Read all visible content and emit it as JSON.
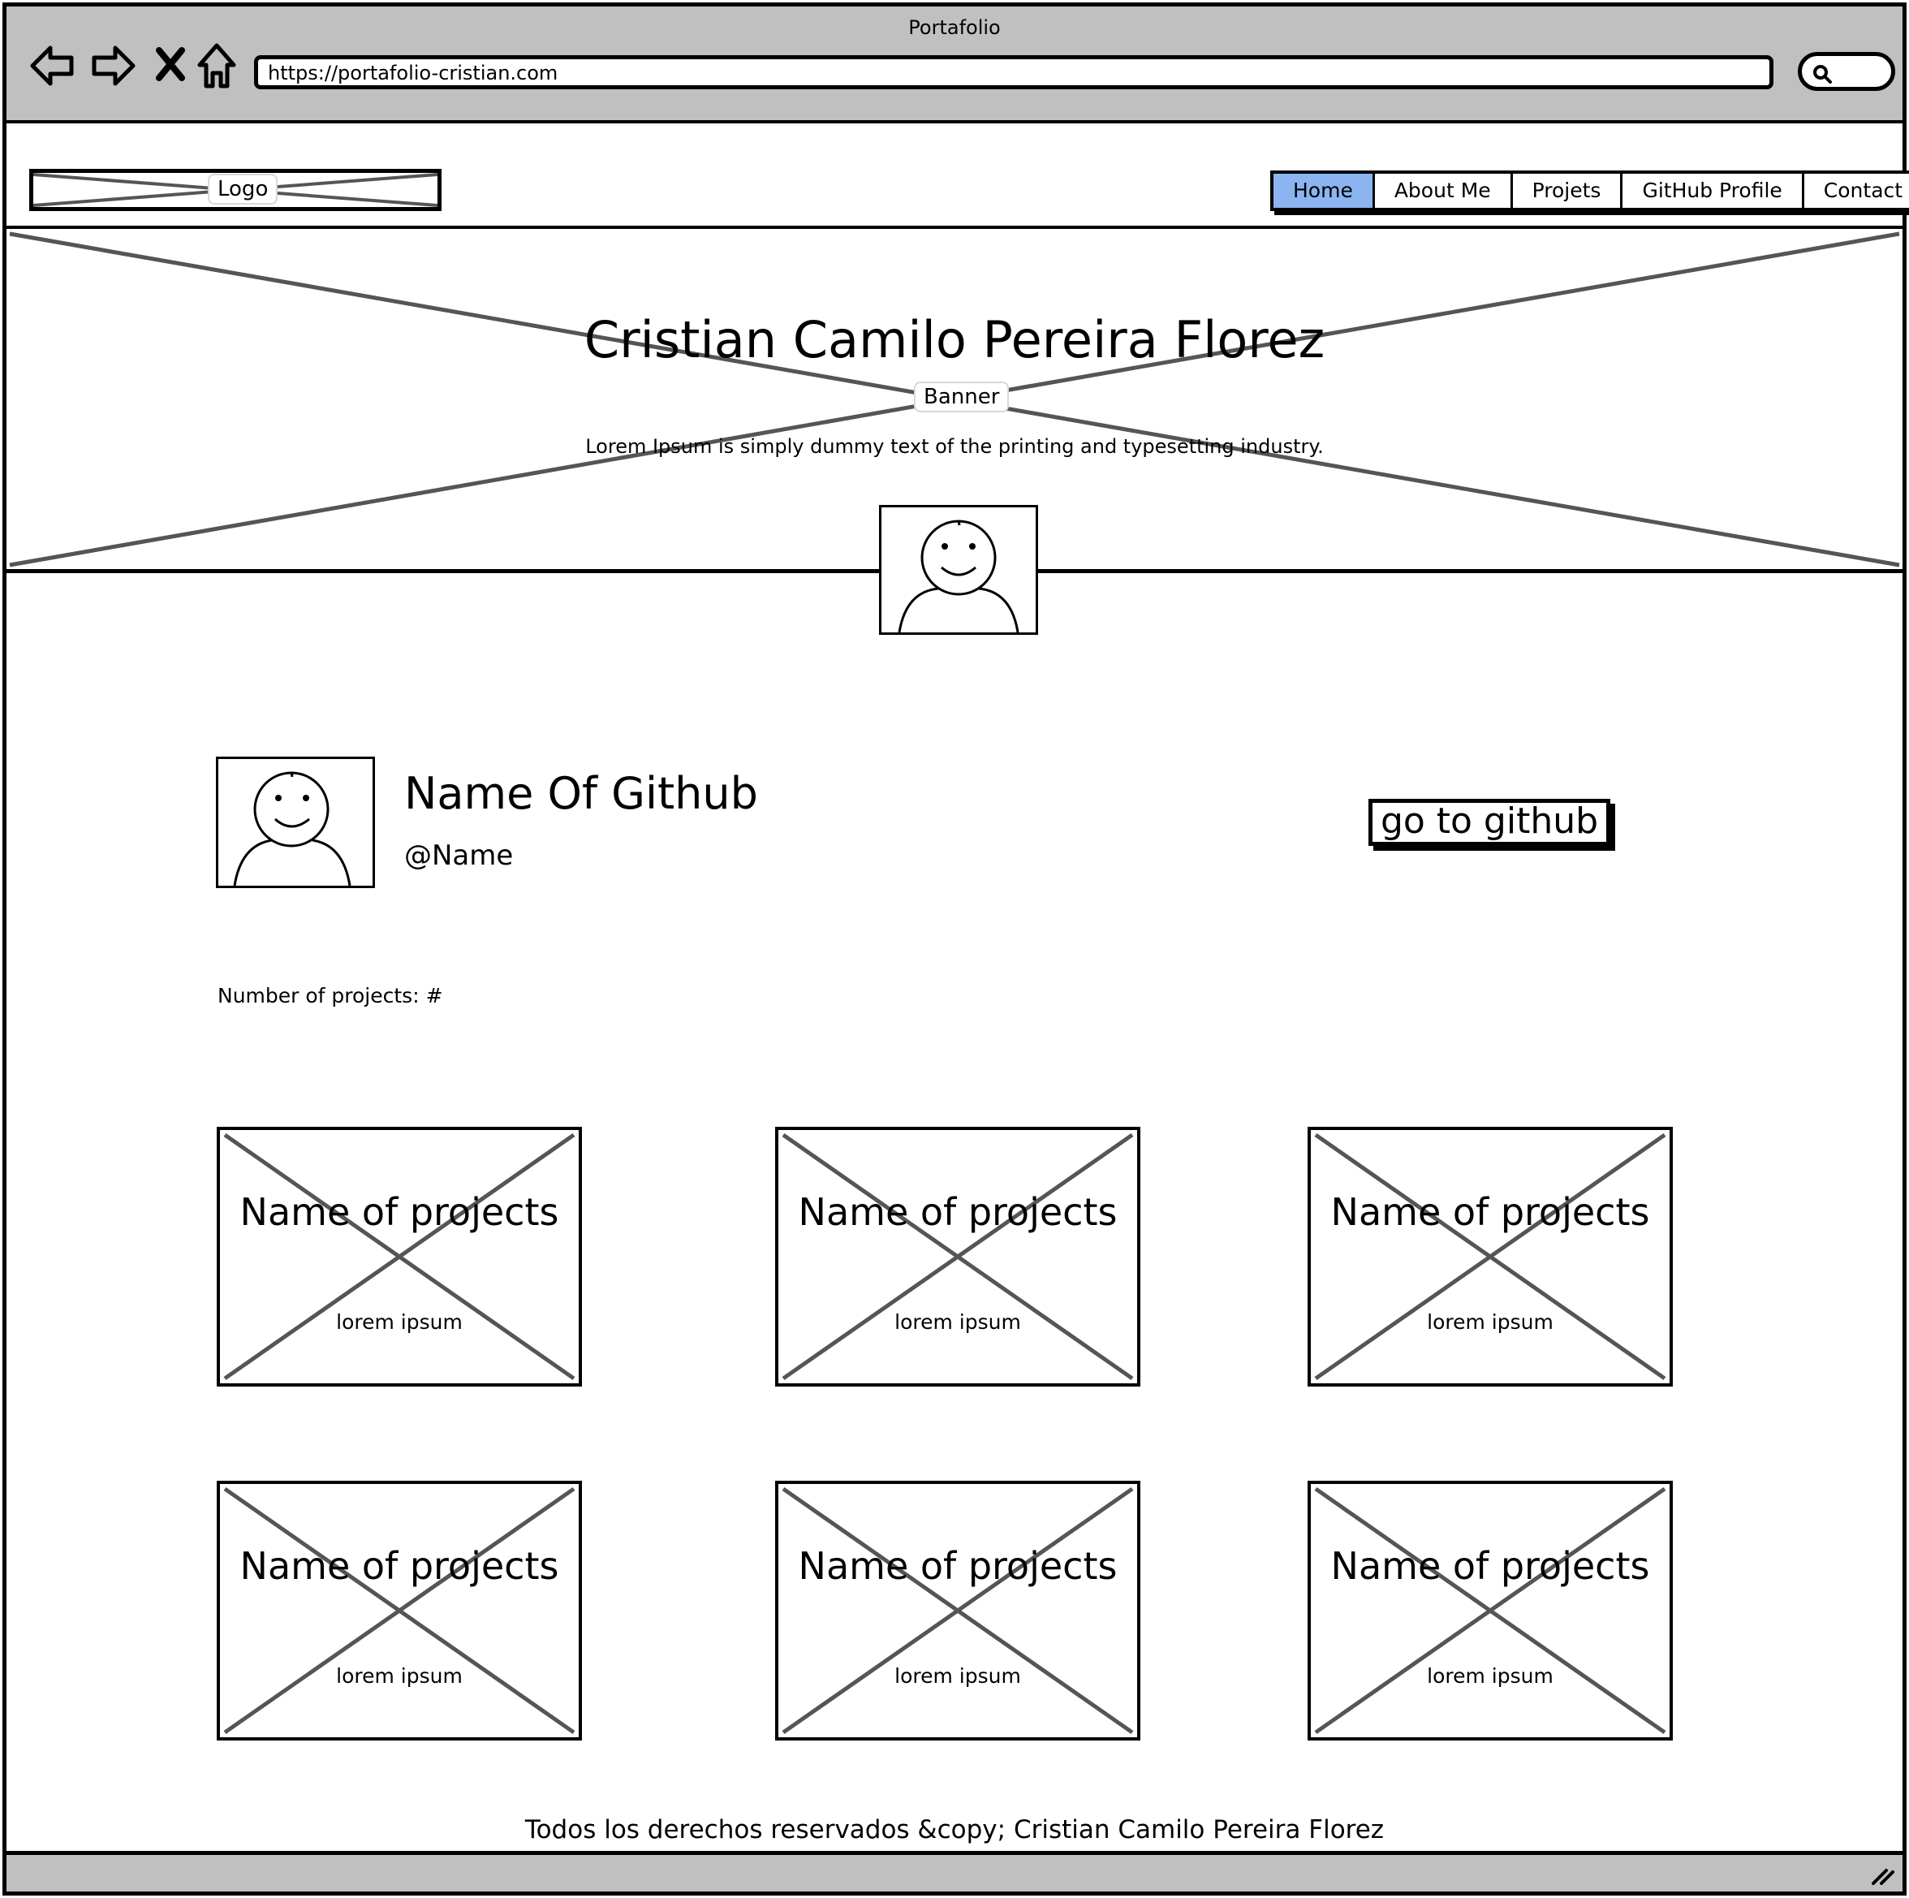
{
  "window": {
    "title": "Portafolio",
    "url": "https://portafolio-cristian.com"
  },
  "header": {
    "logo_label": "Logo",
    "nav": [
      {
        "label": "Home",
        "active": true
      },
      {
        "label": "About Me",
        "active": false
      },
      {
        "label": "Projets",
        "active": false
      },
      {
        "label": "GitHub Profile",
        "active": false
      },
      {
        "label": "Contact",
        "active": false
      }
    ],
    "active_color": "#8bb4f0"
  },
  "banner": {
    "title": "Cristian Camilo Pereira Florez",
    "label": "Banner",
    "text": "Lorem Ipsum is simply dummy text of the printing and typesetting industry."
  },
  "github": {
    "name": "Name Of Github",
    "handle": "@Name",
    "button": "go to github",
    "projects_count": "Number of projects: #"
  },
  "projects": [
    {
      "title": "Name of projects",
      "description": "lorem ipsum"
    },
    {
      "title": "Name of projects",
      "description": "lorem ipsum"
    },
    {
      "title": "Name of projects",
      "description": "lorem ipsum"
    },
    {
      "title": "Name of projects",
      "description": "lorem ipsum"
    },
    {
      "title": "Name of projects",
      "description": "lorem ipsum"
    },
    {
      "title": "Name of projects",
      "description": "lorem ipsum"
    }
  ],
  "footer": {
    "text": "Todos los derechos reservados &copy; Cristian Camilo Pereira Florez"
  },
  "icons": [
    "back-arrow-icon",
    "forward-arrow-icon",
    "stop-icon",
    "home-icon",
    "search-icon",
    "resize-grip-icon",
    "avatar-icon"
  ]
}
